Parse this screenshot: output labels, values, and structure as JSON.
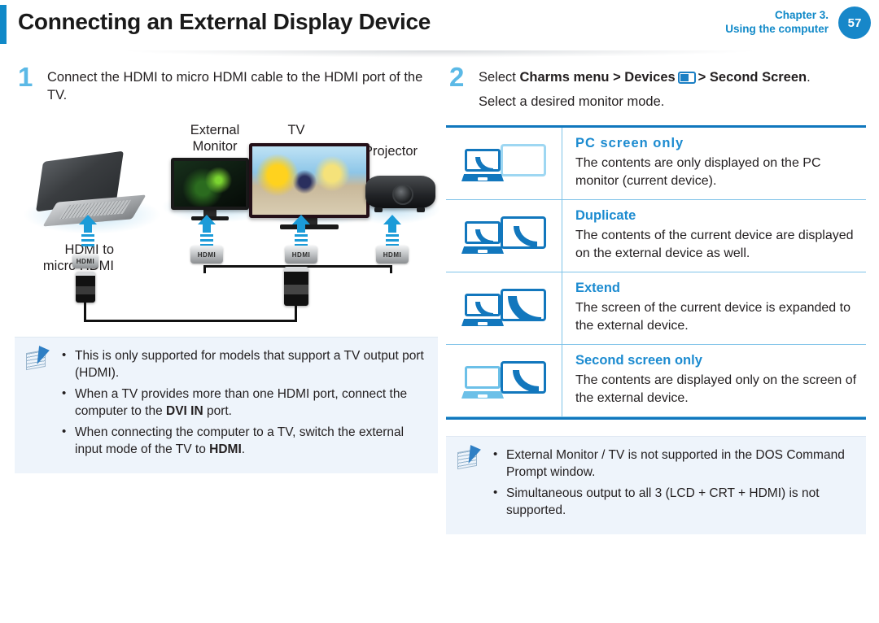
{
  "header": {
    "title": "Connecting an External Display Device",
    "chapter_line1": "Chapter 3.",
    "chapter_line2": "Using the computer",
    "page_number": "57",
    "accent_color": "#1089c8",
    "badge_color": "#1787c9"
  },
  "left": {
    "step_number": "1",
    "step_text": "Connect the HDMI to micro HDMI cable to the HDMI port of the TV.",
    "diagram": {
      "labels": {
        "external_monitor": "External\nMonitor",
        "external_monitor_line1": "External",
        "external_monitor_line2": "Monitor",
        "tv": "TV",
        "projector": "Projector",
        "cable_line1": "HDMI to",
        "cable_line2": "micro HDMI",
        "port_label": "HDMI"
      }
    },
    "note": {
      "icon": "note-pencil-icon",
      "items": [
        {
          "parts": [
            {
              "text": "This is only supported for models that support a TV output port (HDMI).",
              "bold": false
            }
          ]
        },
        {
          "parts": [
            {
              "text": "When a TV provides more than one HDMI port, connect the computer to the ",
              "bold": false
            },
            {
              "text": "DVI IN",
              "bold": true
            },
            {
              "text": " port.",
              "bold": false
            }
          ]
        },
        {
          "parts": [
            {
              "text": "When connecting the computer to a TV, switch the external input mode of the TV to ",
              "bold": false
            },
            {
              "text": "HDMI",
              "bold": true
            },
            {
              "text": ".",
              "bold": false
            }
          ]
        }
      ]
    }
  },
  "right": {
    "step_number": "2",
    "step_line1_parts": [
      {
        "text": "Select ",
        "bold": false
      },
      {
        "text": "Charms menu > Devices",
        "bold": true
      },
      {
        "text": " ",
        "bold": false
      },
      {
        "text": " > Second Screen",
        "bold": true
      },
      {
        "text": ".",
        "bold": false
      }
    ],
    "step_line1_prefix": "Select ",
    "step_line1_bold1": "Charms menu > Devices",
    "step_line1_bold2": "> Second Screen",
    "step_line1_suffix": ".",
    "step_line2": "Select a desired monitor mode.",
    "devices_icon": "devices-charm-icon",
    "modes": [
      {
        "icon": "pc-screen-only-icon",
        "title": "PC screen only",
        "desc": "The contents are only displayed on the PC monitor (current device)."
      },
      {
        "icon": "duplicate-icon",
        "title": "Duplicate",
        "desc": "The contents of the current device are displayed on the external device as well."
      },
      {
        "icon": "extend-icon",
        "title": "Extend",
        "desc": "The screen of the current device is expanded to the external device."
      },
      {
        "icon": "second-screen-only-icon",
        "title": "Second screen only",
        "desc": "The contents are displayed only on the screen of the external device."
      }
    ],
    "note": {
      "icon": "note-pencil-icon",
      "items": [
        {
          "text": "External Monitor / TV is not supported in the DOS Command Prompt window."
        },
        {
          "text": "Simultaneous output to all 3 (LCD + CRT + HDMI) is not supported."
        }
      ]
    }
  }
}
